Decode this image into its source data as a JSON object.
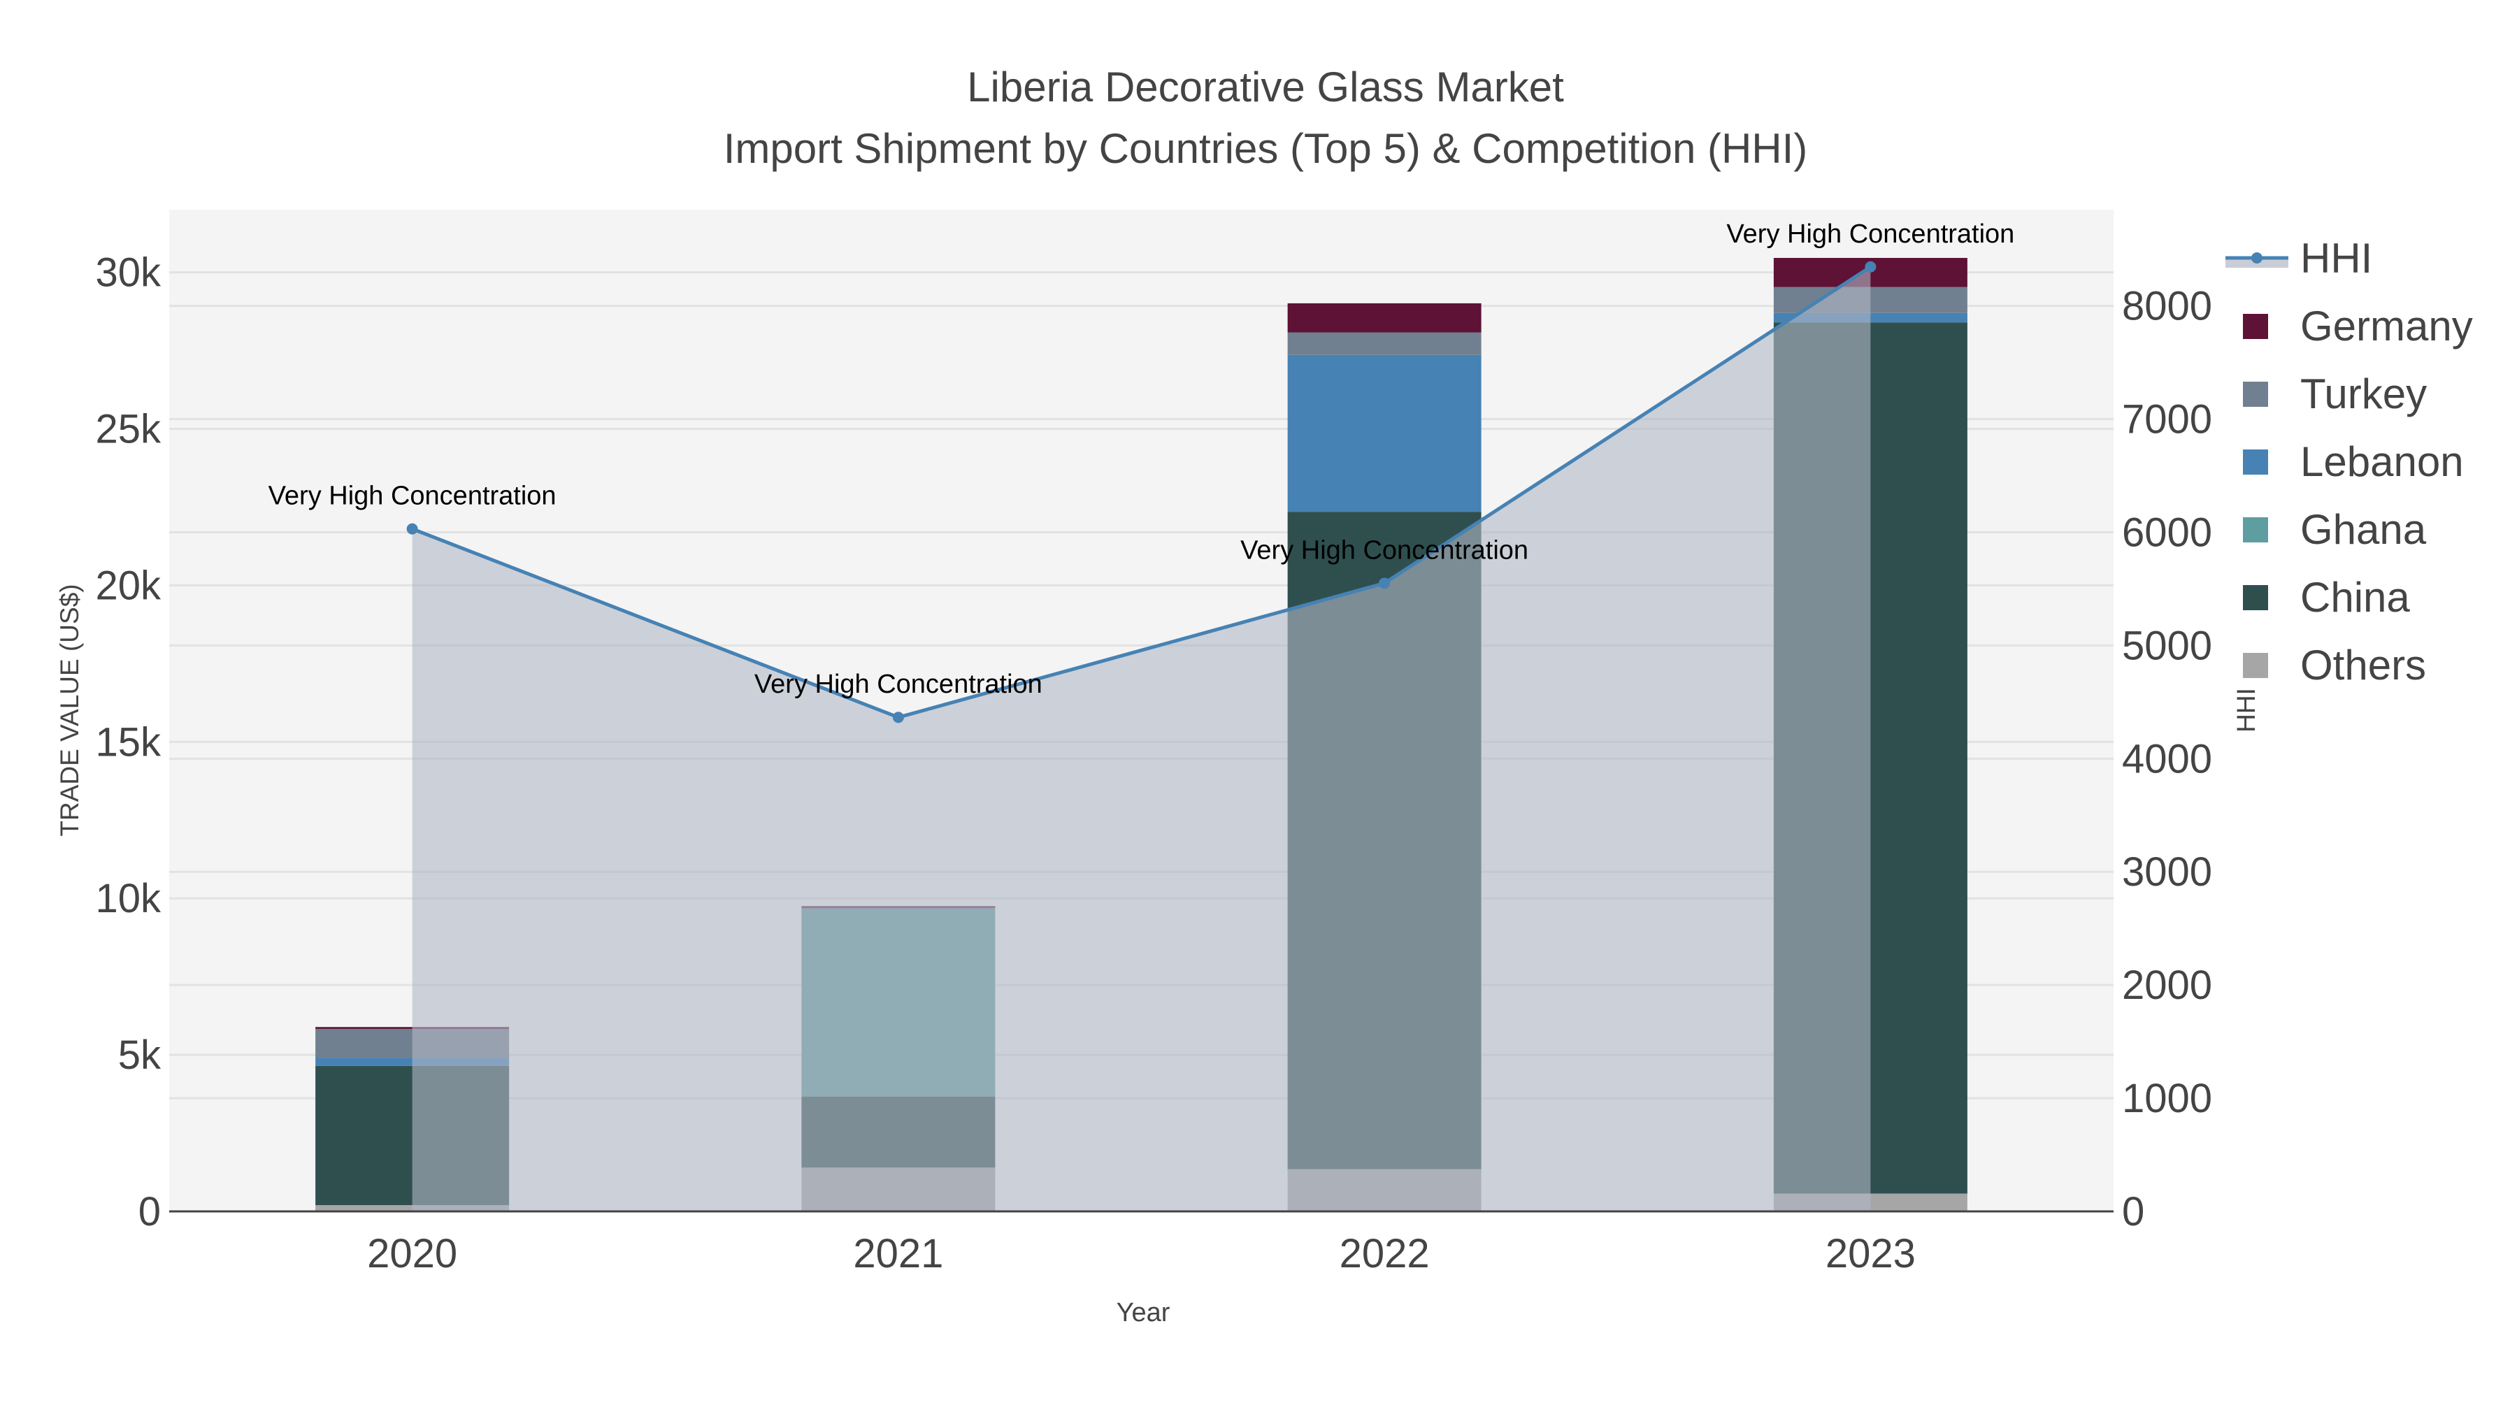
{
  "chart_data": {
    "type": "bar",
    "title": "Liberia Decorative Glass Market",
    "subtitle": "Import Shipment by Countries (Top 5) & Competition (HHI)",
    "xlabel": "Year",
    "ylabel": "TRADE VALUE (US$)",
    "y2label": "HHI",
    "categories": [
      "2020",
      "2021",
      "2022",
      "2023"
    ],
    "ylim": [
      0,
      32000
    ],
    "y2lim": [
      0,
      8850
    ],
    "yticks": [
      0,
      5000,
      10000,
      15000,
      20000,
      25000,
      30000
    ],
    "ytick_labels": [
      "0",
      "5k",
      "10k",
      "15k",
      "20k",
      "25k",
      "30k"
    ],
    "y2ticks": [
      0,
      1000,
      2000,
      3000,
      4000,
      5000,
      6000,
      7000,
      8000
    ],
    "y2tick_labels": [
      "0",
      "1000",
      "2000",
      "3000",
      "4000",
      "5000",
      "6000",
      "7000",
      "8000"
    ],
    "stacked": true,
    "series": [
      {
        "name": "Others",
        "color": "#a6a6a6",
        "values": [
          200,
          1400,
          1350,
          570
        ]
      },
      {
        "name": "China",
        "color": "#2f4f4f",
        "values": [
          4450,
          2270,
          21000,
          27830
        ]
      },
      {
        "name": "Ghana",
        "color": "#5f9ea0",
        "values": [
          0,
          5980,
          0,
          0
        ]
      },
      {
        "name": "Lebanon",
        "color": "#4682b4",
        "values": [
          250,
          0,
          5010,
          300
        ]
      },
      {
        "name": "Turkey",
        "color": "#708090",
        "values": [
          930,
          50,
          720,
          830
        ]
      },
      {
        "name": "Germany",
        "color": "#5e1235",
        "values": [
          60,
          50,
          930,
          930
        ]
      }
    ],
    "line": {
      "name": "HHI",
      "color": "#4682b4",
      "axis": "right",
      "values": [
        6030,
        4365,
        5550,
        8345
      ]
    },
    "annotations": [
      "Very High Concentration",
      "Very High Concentration",
      "Very High Concentration",
      "Very High Concentration"
    ],
    "legend_order": [
      "HHI",
      "Germany",
      "Turkey",
      "Lebanon",
      "Ghana",
      "China",
      "Others"
    ],
    "legend_position": "right",
    "grid": true
  }
}
